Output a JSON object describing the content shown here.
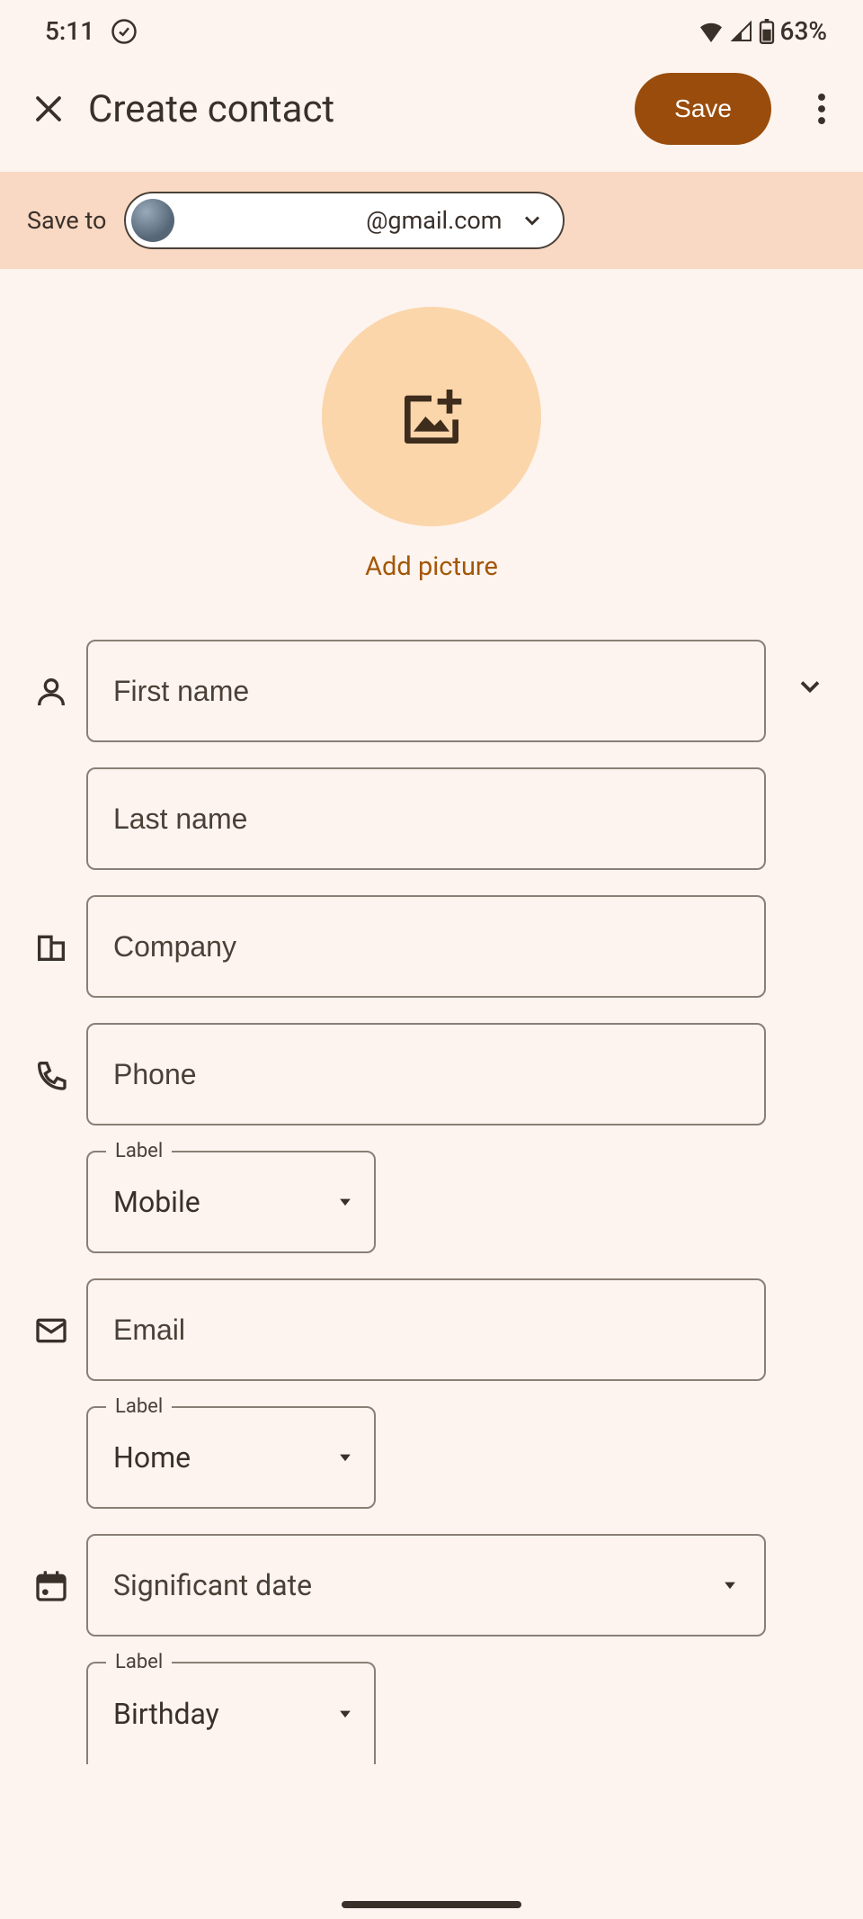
{
  "statusbar": {
    "time": "5:11",
    "battery_pct": "63%"
  },
  "header": {
    "title": "Create contact",
    "save_label": "Save"
  },
  "saveto": {
    "label": "Save to",
    "email": "@gmail.com"
  },
  "photo": {
    "add_label": "Add picture"
  },
  "fields": {
    "first_name": {
      "placeholder": "First name",
      "value": ""
    },
    "last_name": {
      "placeholder": "Last name",
      "value": ""
    },
    "company": {
      "placeholder": "Company",
      "value": ""
    },
    "phone": {
      "placeholder": "Phone",
      "value": ""
    },
    "phone_label": {
      "label": "Label",
      "value": "Mobile"
    },
    "email": {
      "placeholder": "Email",
      "value": ""
    },
    "email_label": {
      "label": "Label",
      "value": "Home"
    },
    "date": {
      "placeholder": "Significant date"
    },
    "date_label": {
      "label": "Label",
      "value": "Birthday"
    }
  }
}
